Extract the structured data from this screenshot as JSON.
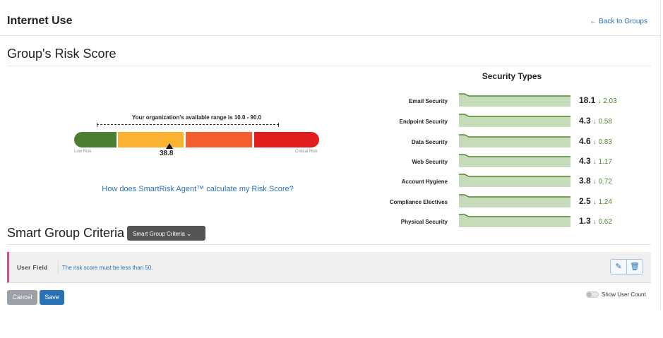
{
  "header": {
    "title": "Internet Use",
    "back_link": "← Back to Groups"
  },
  "risk": {
    "title": "Group's Risk Score",
    "range_text": "Your organization's available range is 10.0 - 90.0",
    "score": "38.8",
    "score_value": 38.8,
    "range_min": 10.0,
    "range_max": 90.0,
    "low_label": "Low Risk",
    "critical_label": "Critical Risk",
    "segment_colors": [
      "#4a7f33",
      "#fbb232",
      "#f35d2f",
      "#e21d1d"
    ],
    "calc_link": "How does SmartRisk Agent™ calculate my Risk Score?"
  },
  "security_types": {
    "title": "Security Types",
    "items": [
      {
        "label": "Email Security",
        "value": "18.1",
        "delta": "2.03"
      },
      {
        "label": "Endpoint Security",
        "value": "4.3",
        "delta": "0.58"
      },
      {
        "label": "Data Security",
        "value": "4.6",
        "delta": "0.83"
      },
      {
        "label": "Web Security",
        "value": "4.3",
        "delta": "1.17"
      },
      {
        "label": "Account Hygiene",
        "value": "3.8",
        "delta": "0.72"
      },
      {
        "label": "Compliance Electives",
        "value": "2.5",
        "delta": "1.24"
      },
      {
        "label": "Physical Security",
        "value": "1.3",
        "delta": "0.62"
      }
    ],
    "delta_icon": "arrow-down-icon",
    "spark_fill": "#c6dbb9",
    "spark_line": "#4e8a2c"
  },
  "criteria": {
    "title": "Smart Group Criteria",
    "dropdown": "Smart Group Criteria",
    "field": "User Field",
    "rule": "The risk score must be less than 50.",
    "edit_icon": "edit-icon",
    "delete_icon": "trash-icon"
  },
  "actions": {
    "cancel": "Cancel",
    "save": "Save",
    "show_user_count": "Show User Count"
  }
}
